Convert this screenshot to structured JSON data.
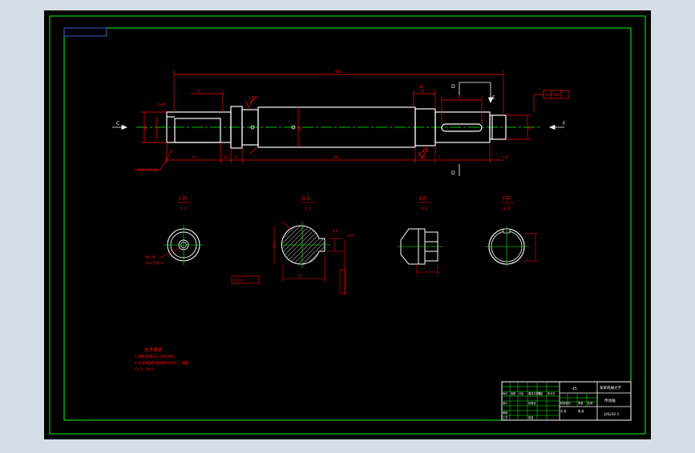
{
  "colors": {
    "app_bg": "#d5dde6",
    "canvas": "#000000",
    "frame": "#00ff00",
    "drawing": "#ffffff",
    "dimension": "#ff0000",
    "centerline": "#00ff00",
    "accent_blue": "#3a5fcd",
    "cut_marker": "#ffffff"
  },
  "main_view": {
    "overall_length": "400",
    "left_arrow_label": "C",
    "right_arrow_label": "F",
    "top_cut_label": "D",
    "bottom_cut_label": "D",
    "side_cut_label": "E",
    "dim_left_bottom": "45",
    "dim_bottom_1": "10",
    "dim_bottom_2": "15",
    "dim_bottom_long": "186",
    "dim_bottom_3": "22",
    "dim_bottom_4": "3",
    "dim_bottom_right": "1.6",
    "dim_keyway": "45",
    "tol_left": "M30×1.5-6g",
    "tol_right": "0.05 A B",
    "roughness_1": "1.6",
    "roughness_2": "3.2",
    "dia_left": "30",
    "dia_mid": "40",
    "dia_right": "35",
    "chamfer_left": "2×45°",
    "dim_top_left": "45",
    "dim_top_mid": "40",
    "dim_top_right": "10"
  },
  "section_views": [
    {
      "title": "C向",
      "scale": "1:1"
    },
    {
      "title": "D-D",
      "scale": "1:1"
    },
    {
      "title": "E向",
      "scale": "1:1"
    },
    {
      "title": "F向",
      "scale": "2:1"
    }
  ],
  "section_notes": {
    "c_note_1": "M6-7H",
    "c_note_2": "深12孔深15",
    "d_width": "12",
    "d_depth": "35.5",
    "d_tol": "0.03 A",
    "d_side_1": "0.05",
    "d_side_2": "3.2"
  },
  "tech_requirements": {
    "title": "技术要求",
    "lines": [
      "1.调质处理220-250HBS",
      "2.未注倒角及倒圆角均为45°，倒角",
      "C0.5、R0.5"
    ]
  },
  "title_block": {
    "material": "45",
    "school": "某某机械大学",
    "part_name": "传动轴",
    "drawing_no": "JXSJ-02-3",
    "row1": [
      "标记",
      "处数",
      "分区",
      "更改文件号",
      "签名",
      "年月日"
    ],
    "row2": [
      "设计",
      "",
      "标准化",
      "",
      "阶段标记",
      "重量",
      "比例"
    ],
    "row3": [
      "审核",
      "",
      "",
      ""
    ],
    "row4": [
      "工艺",
      "",
      "批准",
      "",
      "共 张",
      "第 张"
    ]
  }
}
